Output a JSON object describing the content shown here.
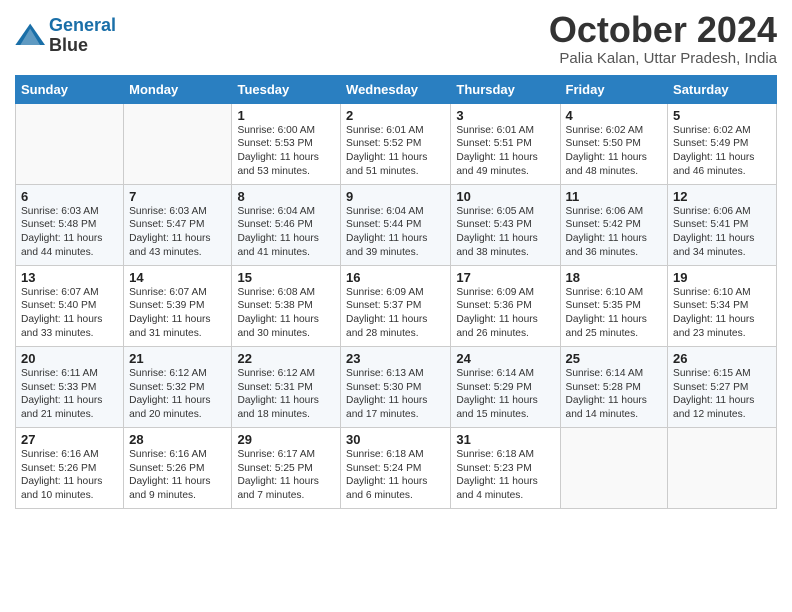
{
  "header": {
    "logo_line1": "General",
    "logo_line2": "Blue",
    "month_title": "October 2024",
    "location": "Palia Kalan, Uttar Pradesh, India"
  },
  "weekdays": [
    "Sunday",
    "Monday",
    "Tuesday",
    "Wednesday",
    "Thursday",
    "Friday",
    "Saturday"
  ],
  "weeks": [
    [
      null,
      null,
      {
        "day": "1",
        "sunrise": "6:00 AM",
        "sunset": "5:53 PM",
        "daylight": "11 hours and 53 minutes."
      },
      {
        "day": "2",
        "sunrise": "6:01 AM",
        "sunset": "5:52 PM",
        "daylight": "11 hours and 51 minutes."
      },
      {
        "day": "3",
        "sunrise": "6:01 AM",
        "sunset": "5:51 PM",
        "daylight": "11 hours and 49 minutes."
      },
      {
        "day": "4",
        "sunrise": "6:02 AM",
        "sunset": "5:50 PM",
        "daylight": "11 hours and 48 minutes."
      },
      {
        "day": "5",
        "sunrise": "6:02 AM",
        "sunset": "5:49 PM",
        "daylight": "11 hours and 46 minutes."
      }
    ],
    [
      {
        "day": "6",
        "sunrise": "6:03 AM",
        "sunset": "5:48 PM",
        "daylight": "11 hours and 44 minutes."
      },
      {
        "day": "7",
        "sunrise": "6:03 AM",
        "sunset": "5:47 PM",
        "daylight": "11 hours and 43 minutes."
      },
      {
        "day": "8",
        "sunrise": "6:04 AM",
        "sunset": "5:46 PM",
        "daylight": "11 hours and 41 minutes."
      },
      {
        "day": "9",
        "sunrise": "6:04 AM",
        "sunset": "5:44 PM",
        "daylight": "11 hours and 39 minutes."
      },
      {
        "day": "10",
        "sunrise": "6:05 AM",
        "sunset": "5:43 PM",
        "daylight": "11 hours and 38 minutes."
      },
      {
        "day": "11",
        "sunrise": "6:06 AM",
        "sunset": "5:42 PM",
        "daylight": "11 hours and 36 minutes."
      },
      {
        "day": "12",
        "sunrise": "6:06 AM",
        "sunset": "5:41 PM",
        "daylight": "11 hours and 34 minutes."
      }
    ],
    [
      {
        "day": "13",
        "sunrise": "6:07 AM",
        "sunset": "5:40 PM",
        "daylight": "11 hours and 33 minutes."
      },
      {
        "day": "14",
        "sunrise": "6:07 AM",
        "sunset": "5:39 PM",
        "daylight": "11 hours and 31 minutes."
      },
      {
        "day": "15",
        "sunrise": "6:08 AM",
        "sunset": "5:38 PM",
        "daylight": "11 hours and 30 minutes."
      },
      {
        "day": "16",
        "sunrise": "6:09 AM",
        "sunset": "5:37 PM",
        "daylight": "11 hours and 28 minutes."
      },
      {
        "day": "17",
        "sunrise": "6:09 AM",
        "sunset": "5:36 PM",
        "daylight": "11 hours and 26 minutes."
      },
      {
        "day": "18",
        "sunrise": "6:10 AM",
        "sunset": "5:35 PM",
        "daylight": "11 hours and 25 minutes."
      },
      {
        "day": "19",
        "sunrise": "6:10 AM",
        "sunset": "5:34 PM",
        "daylight": "11 hours and 23 minutes."
      }
    ],
    [
      {
        "day": "20",
        "sunrise": "6:11 AM",
        "sunset": "5:33 PM",
        "daylight": "11 hours and 21 minutes."
      },
      {
        "day": "21",
        "sunrise": "6:12 AM",
        "sunset": "5:32 PM",
        "daylight": "11 hours and 20 minutes."
      },
      {
        "day": "22",
        "sunrise": "6:12 AM",
        "sunset": "5:31 PM",
        "daylight": "11 hours and 18 minutes."
      },
      {
        "day": "23",
        "sunrise": "6:13 AM",
        "sunset": "5:30 PM",
        "daylight": "11 hours and 17 minutes."
      },
      {
        "day": "24",
        "sunrise": "6:14 AM",
        "sunset": "5:29 PM",
        "daylight": "11 hours and 15 minutes."
      },
      {
        "day": "25",
        "sunrise": "6:14 AM",
        "sunset": "5:28 PM",
        "daylight": "11 hours and 14 minutes."
      },
      {
        "day": "26",
        "sunrise": "6:15 AM",
        "sunset": "5:27 PM",
        "daylight": "11 hours and 12 minutes."
      }
    ],
    [
      {
        "day": "27",
        "sunrise": "6:16 AM",
        "sunset": "5:26 PM",
        "daylight": "11 hours and 10 minutes."
      },
      {
        "day": "28",
        "sunrise": "6:16 AM",
        "sunset": "5:26 PM",
        "daylight": "11 hours and 9 minutes."
      },
      {
        "day": "29",
        "sunrise": "6:17 AM",
        "sunset": "5:25 PM",
        "daylight": "11 hours and 7 minutes."
      },
      {
        "day": "30",
        "sunrise": "6:18 AM",
        "sunset": "5:24 PM",
        "daylight": "11 hours and 6 minutes."
      },
      {
        "day": "31",
        "sunrise": "6:18 AM",
        "sunset": "5:23 PM",
        "daylight": "11 hours and 4 minutes."
      },
      null,
      null
    ]
  ]
}
